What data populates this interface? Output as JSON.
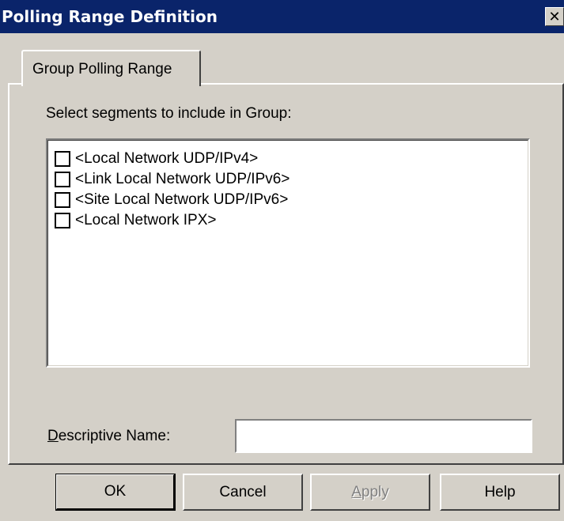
{
  "window": {
    "title": "Polling Range Definition",
    "close_glyph": "✕"
  },
  "tabs": [
    {
      "label": "Group Polling Range",
      "active": true
    }
  ],
  "group": {
    "select_label": "Select segments to include in Group:",
    "segments": [
      {
        "label": "<Local Network UDP/IPv4>",
        "checked": false
      },
      {
        "label": "<Link Local Network UDP/IPv6>",
        "checked": false
      },
      {
        "label": "<Site Local Network UDP/IPv6>",
        "checked": false
      },
      {
        "label": "<Local Network IPX>",
        "checked": false
      }
    ],
    "descriptive_name": {
      "label_first": "D",
      "label_rest": "escriptive Name:",
      "value": "",
      "placeholder": ""
    }
  },
  "buttons": {
    "ok": "OK",
    "cancel": "Cancel",
    "apply_first": "A",
    "apply_rest": "pply",
    "help": "Help"
  },
  "icons": {
    "close": "close-icon"
  }
}
